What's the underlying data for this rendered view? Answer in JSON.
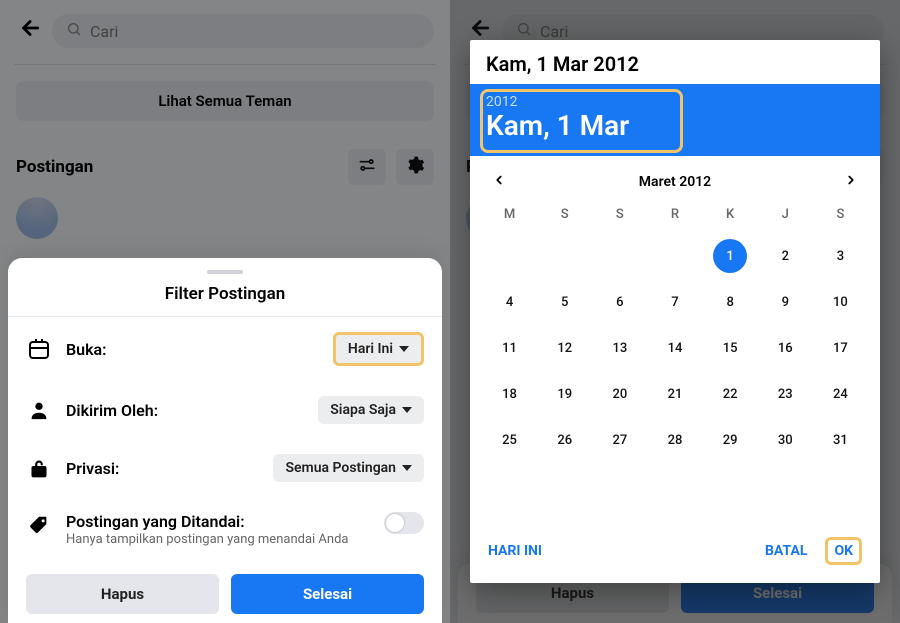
{
  "left": {
    "search_placeholder": "Cari",
    "see_all_friends": "Lihat Semua Teman",
    "section_title": "Postingan",
    "filter_title": "Filter Postingan",
    "rows": {
      "open": {
        "label": "Buka:",
        "value": "Hari Ini"
      },
      "sent": {
        "label": "Dikirim Oleh:",
        "value": "Siapa Saja"
      },
      "privacy": {
        "label": "Privasi:",
        "value": "Semua Postingan"
      },
      "tagged": {
        "label": "Postingan yang Ditandai:",
        "sub": "Hanya tampilkan postingan yang menandai Anda"
      }
    },
    "actions": {
      "clear": "Hapus",
      "done": "Selesai"
    }
  },
  "right": {
    "title": "Kam, 1 Mar 2012",
    "year": "2012",
    "day_display": "Kam, 1 Mar",
    "month_label": "Maret 2012",
    "dow": [
      "M",
      "S",
      "S",
      "R",
      "K",
      "J",
      "S"
    ],
    "leading_blanks": 4,
    "days": 31,
    "selected": 1,
    "actions": {
      "today": "HARI INI",
      "cancel": "BATAL",
      "ok": "OK"
    },
    "behind_actions": {
      "clear": "Hapus",
      "done": "Selesai"
    }
  }
}
